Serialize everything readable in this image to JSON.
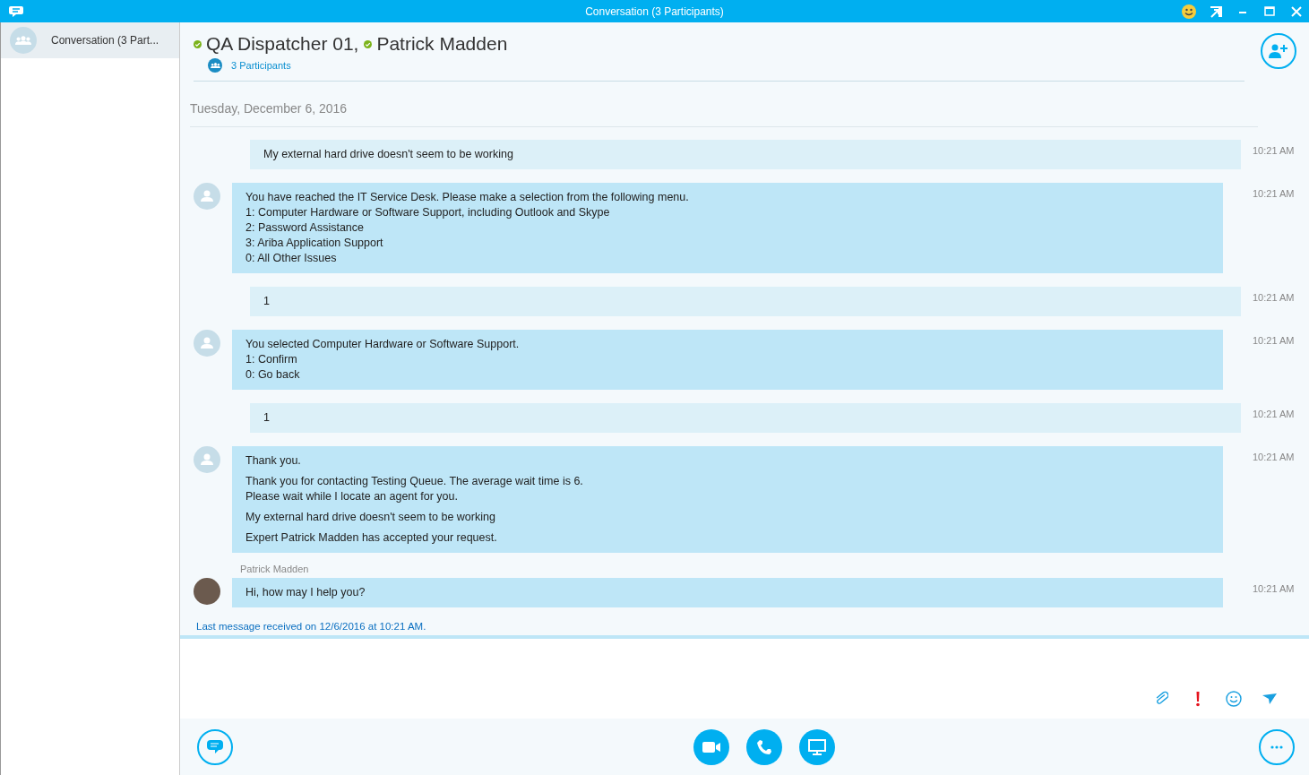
{
  "window": {
    "title": "Conversation (3 Participants)"
  },
  "sidebar": {
    "items": [
      {
        "label": "Conversation (3 Part...",
        "selected": true
      }
    ]
  },
  "header": {
    "participants": [
      {
        "name": "QA Dispatcher 01,",
        "online": true
      },
      {
        "name": "Patrick Madden",
        "online": true
      }
    ],
    "participant_count": "3 Participants"
  },
  "date": "Tuesday, December 6, 2016",
  "messages": [
    {
      "kind": "sent",
      "paragraphs": [
        [
          "My external hard drive doesn't seem to be working"
        ]
      ],
      "time": "10:21 AM"
    },
    {
      "kind": "received",
      "paragraphs": [
        [
          "You have reached the IT Service Desk. Please make a selection from the following menu.",
          "1: Computer Hardware or Software Support, including Outlook and Skype",
          "2: Password Assistance",
          "3: Ariba Application Support",
          "0: All Other Issues"
        ]
      ],
      "time": "10:21 AM"
    },
    {
      "kind": "sent",
      "paragraphs": [
        [
          "1"
        ]
      ],
      "time": "10:21 AM"
    },
    {
      "kind": "received",
      "paragraphs": [
        [
          "You selected Computer Hardware or Software Support.",
          "1: Confirm",
          "0: Go back"
        ]
      ],
      "time": "10:21 AM"
    },
    {
      "kind": "sent",
      "paragraphs": [
        [
          "1"
        ]
      ],
      "time": "10:21 AM"
    },
    {
      "kind": "received",
      "paragraphs": [
        [
          "Thank you."
        ],
        [
          "Thank you for contacting Testing Queue. The average wait time is 6.",
          "Please wait while I locate an agent for you."
        ],
        [
          "My external hard drive doesn't seem to be working"
        ],
        [
          "Expert Patrick Madden has accepted your request."
        ]
      ],
      "time": "10:21 AM"
    },
    {
      "kind": "received",
      "sender": "Patrick Madden",
      "photo": true,
      "paragraphs": [
        [
          "Hi, how may I help you?"
        ]
      ],
      "time": "10:21 AM"
    }
  ],
  "status": "Last message received on 12/6/2016 at 10:21 AM."
}
